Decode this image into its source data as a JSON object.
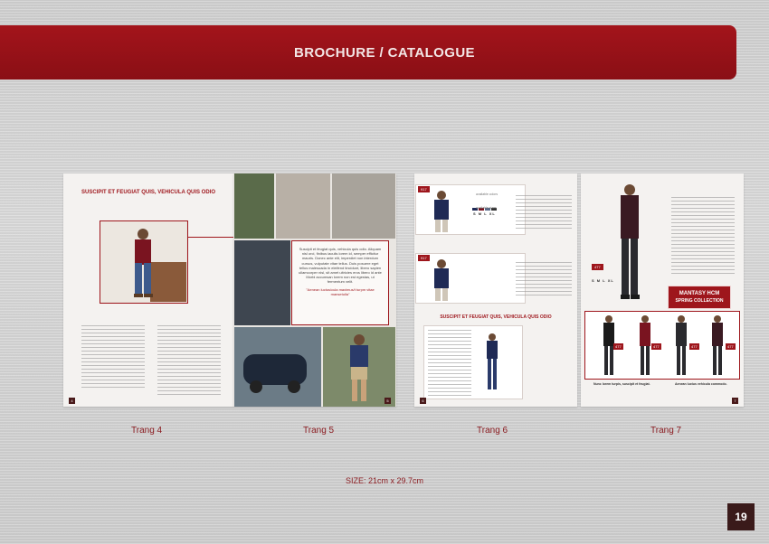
{
  "banner": {
    "title": "BROCHURE / CATALOGUE"
  },
  "pages": [
    {
      "label": "Trang 4",
      "number": "4"
    },
    {
      "label": "Trang 5",
      "number": "5"
    },
    {
      "label": "Trang 6",
      "number": "6"
    },
    {
      "label": "Trang 7",
      "number": "7"
    }
  ],
  "page4": {
    "heading": "SUSCIPIT ET FEUGIAT QUIS, VEHICULA QUIS ODIO"
  },
  "page5": {
    "quote": "Suscipit et feugiat quis, vehicula quis odio. Aliquam nisl orci, finibus iaculis lorem id, semper efficitur mauris. Donec ante elit, imperdiet non interdum cursus, vulputate vitae tellus. Duis posuere eget tellus malesuada in eleifend tincidunt, libero sapien ullamcorper nisl, sit amet ultricies eros libero id ante Morbi accumsan lorem non est egestas, ut fermentum velit.",
    "quote_red": "\"Aenean luctus/cula maximus/t turpm vitae mansetulla\""
  },
  "page6": {
    "heading": "SUSCIPIT ET FEUGIAT QUIS, VEHICULA QUIS ODIO",
    "badges": [
      "917",
      "917"
    ],
    "available_colors": "available colors",
    "available_sizes": "available sizes",
    "sizes": "S M L XL"
  },
  "page7": {
    "badge_main": "477",
    "badges_row": [
      "477",
      "477",
      "477",
      "477"
    ],
    "collection_line1": "MANTASY HCM",
    "collection_line2": "SPRING COLLECTION",
    "sizes": "S M L XL",
    "caption_left": "Nunc lorem turpis, suscipit et feugiat.",
    "caption_right": "Aenean luctus vehicula commodo."
  },
  "size_note": "SIZE: 21cm x 29.7cm",
  "sheet_number": "19",
  "colors": {
    "brand_red": "#9e161c",
    "dark_badge": "#3a1a1a"
  }
}
